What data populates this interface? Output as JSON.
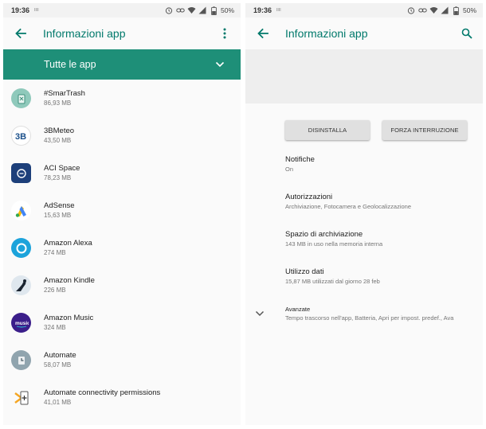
{
  "status": {
    "time": "19:36",
    "small_label": "IIII",
    "battery": "50%"
  },
  "left": {
    "title": "Informazioni app",
    "filter_label": "Tutte le app",
    "apps": [
      {
        "name": "#SmarTrash",
        "size": "86,93 MB",
        "icon": "smartrash-icon",
        "color": "#6fb8a6"
      },
      {
        "name": "3BMeteo",
        "size": "43,50 MB",
        "icon": "3bmeteo-icon",
        "color": "#1a4f8a"
      },
      {
        "name": "ACI Space",
        "size": "78,23 MB",
        "icon": "aci-space-icon",
        "color": "#1d3f7a"
      },
      {
        "name": "AdSense",
        "size": "15,63 MB",
        "icon": "adsense-icon",
        "color": "#fbbc04"
      },
      {
        "name": "Amazon Alexa",
        "size": "274 MB",
        "icon": "alexa-icon",
        "color": "#1ca3db"
      },
      {
        "name": "Amazon Kindle",
        "size": "226 MB",
        "icon": "kindle-icon",
        "color": "#1b2430"
      },
      {
        "name": "Amazon Music",
        "size": "324 MB",
        "icon": "amazon-music-icon",
        "color": "#3b1e8a"
      },
      {
        "name": "Automate",
        "size": "58,07 MB",
        "icon": "automate-icon",
        "color": "#78909c"
      },
      {
        "name": "Automate connectivity permissions",
        "size": "41,01 MB",
        "icon": "automate-connectivity-icon",
        "color": "#f5a623"
      }
    ]
  },
  "right": {
    "title": "Informazioni app",
    "buttons": {
      "uninstall": "DISINSTALLA",
      "force_stop": "FORZA INTERRUZIONE"
    },
    "settings": [
      {
        "title": "Notifiche",
        "subtitle": "On"
      },
      {
        "title": "Autorizzazioni",
        "subtitle": "Archiviazione, Fotocamera e Geolocalizzazione"
      },
      {
        "title": "Spazio di archiviazione",
        "subtitle": "143 MB in uso nella memoria interna"
      },
      {
        "title": "Utilizzo dati",
        "subtitle": "15,87 MB utilizzati dal giorno 28 feb"
      }
    ],
    "advanced": {
      "title": "Avanzate",
      "subtitle": "Tempo trascorso nell'app, Batteria, Apri per impost. predef., Ava"
    }
  },
  "colors": {
    "accent": "#00796b",
    "filter_bg": "#1e8f78"
  }
}
